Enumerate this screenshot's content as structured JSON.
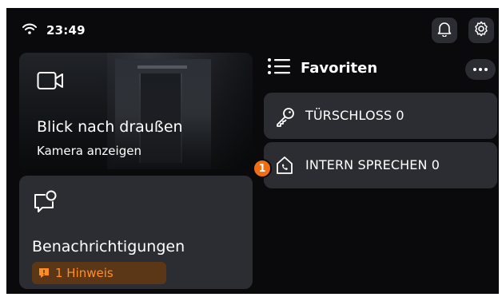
{
  "status_bar": {
    "time": "23:49",
    "wifi_icon": "wifi-icon",
    "bell_icon": "bell-icon",
    "settings_icon": "gear-icon"
  },
  "camera_card": {
    "icon": "video-camera-icon",
    "title": "Blick nach draußen",
    "subtitle": "Kamera anzeigen"
  },
  "notifications_card": {
    "icon": "chat-bubble-icon",
    "title": "Benachrichtigungen",
    "hint": "1 Hinweis",
    "hint_color": "#ff8e24"
  },
  "favorites": {
    "title": "Favoriten",
    "items": [
      {
        "label": "TÜRSCHLOSS 0",
        "icon": "key-icon"
      },
      {
        "label": "INTERN SPRECHEN 0",
        "icon": "house-phone-icon",
        "badge": "1"
      }
    ]
  },
  "colors": {
    "background": "#0a0a0c",
    "card": "#2c2d33",
    "accent": "#f06d18"
  }
}
